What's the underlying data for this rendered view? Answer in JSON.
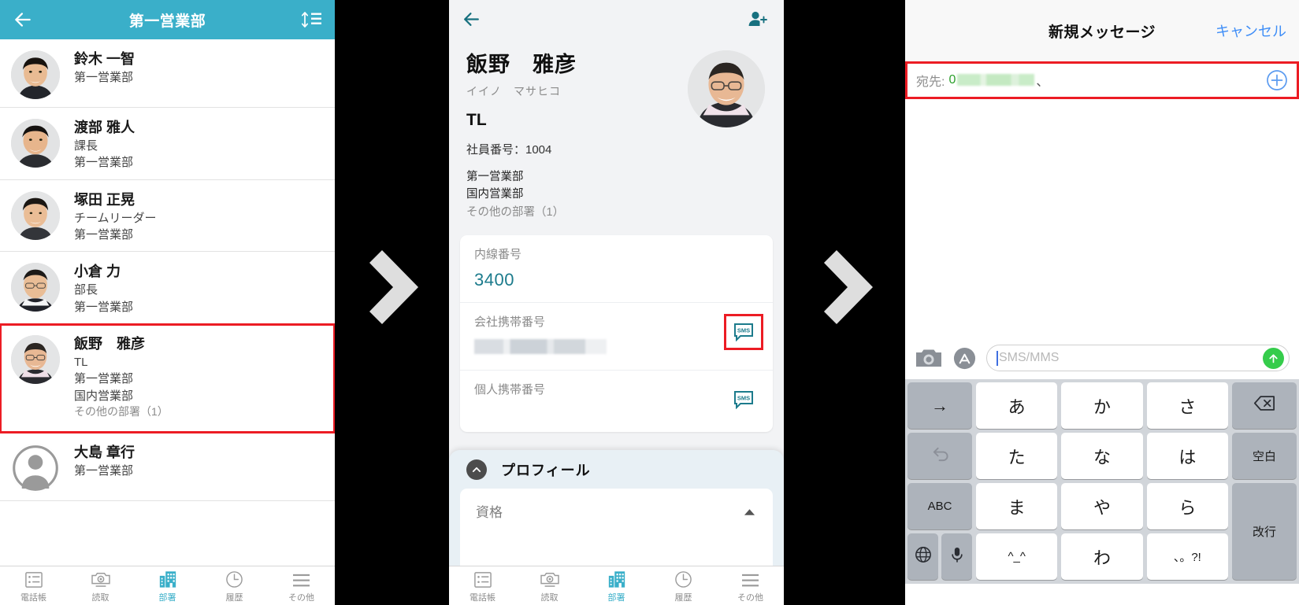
{
  "panel1": {
    "header": {
      "title": "第一営業部",
      "back_icon": "back-arrow-icon",
      "sort_icon": "sort-icon"
    },
    "rows": [
      {
        "name": "鈴木 一智",
        "role": "",
        "depts": [
          "第一営業部"
        ],
        "other": "",
        "selected": false,
        "avatar": "photo-man-1"
      },
      {
        "name": "渡部 雅人",
        "role": "課長",
        "depts": [
          "第一営業部"
        ],
        "other": "",
        "selected": false,
        "avatar": "photo-man-2"
      },
      {
        "name": "塚田 正晃",
        "role": "チームリーダー",
        "depts": [
          "第一営業部"
        ],
        "other": "",
        "selected": false,
        "avatar": "photo-man-3"
      },
      {
        "name": "小倉 力",
        "role": "部長",
        "depts": [
          "第一営業部"
        ],
        "other": "",
        "selected": false,
        "avatar": "photo-man-4"
      },
      {
        "name": "飯野　雅彦",
        "role": "TL",
        "depts": [
          "第一営業部",
          "国内営業部"
        ],
        "other": "その他の部署（1）",
        "selected": true,
        "avatar": "photo-man-5"
      },
      {
        "name": "大島 章行",
        "role": "",
        "depts": [
          "第一営業部"
        ],
        "other": "",
        "selected": false,
        "avatar": "placeholder-person"
      }
    ]
  },
  "tabbar": {
    "items": [
      {
        "label": "電話帳",
        "icon": "contact-list-icon",
        "active": false
      },
      {
        "label": "読取",
        "icon": "camera-scan-icon",
        "active": false
      },
      {
        "label": "部署",
        "icon": "building-icon",
        "active": true
      },
      {
        "label": "履歴",
        "icon": "clock-icon",
        "active": false
      },
      {
        "label": "その他",
        "icon": "hamburger-icon",
        "active": false
      }
    ]
  },
  "panel2": {
    "back_icon": "back-arrow-icon",
    "adduser_icon": "add-person-icon",
    "person": {
      "name": "飯野　雅彦",
      "kana": "イイノ　マサヒコ",
      "role": "TL",
      "employee_no": "社員番号：1004",
      "depts": [
        "第一営業部",
        "国内営業部"
      ],
      "other_depts": "その他の部署（1）"
    },
    "fields": [
      {
        "label": "内線番号",
        "value": "3400",
        "redacted": false,
        "sms": false
      },
      {
        "label": "会社携帯番号",
        "value": "",
        "redacted": true,
        "sms": true,
        "sms_highlighted": true
      },
      {
        "label": "個人携帯番号",
        "value": "",
        "redacted": false,
        "sms": true,
        "sms_highlighted": false
      }
    ],
    "profile_sheet": {
      "title": "プロフィール",
      "collapse_icon": "chevron-up-icon",
      "row_label": "資格",
      "row_caret": "caret-up-icon"
    }
  },
  "panel3": {
    "nav": {
      "title": "新規メッセージ",
      "cancel": "キャンセル"
    },
    "to_field": {
      "label": "宛先:",
      "value_prefix": "0",
      "value_redacted": true,
      "separator": "、",
      "add_icon": "add-circle-icon"
    },
    "input_bar": {
      "camera_icon": "camera-icon",
      "appstore_icon": "app-store-icon",
      "placeholder": "SMS/MMS",
      "send_icon": "send-arrow-icon"
    },
    "keyboard": {
      "rows": [
        [
          {
            "label": "→",
            "style": "gray"
          },
          {
            "label": "あ",
            "style": "white"
          },
          {
            "label": "か",
            "style": "white"
          },
          {
            "label": "さ",
            "style": "white"
          },
          {
            "label": "⌫",
            "style": "gray",
            "icon": "backspace-icon"
          }
        ],
        [
          {
            "label": "↺",
            "style": "gray",
            "icon": "undo-icon"
          },
          {
            "label": "た",
            "style": "white"
          },
          {
            "label": "な",
            "style": "white"
          },
          {
            "label": "は",
            "style": "white"
          },
          {
            "label": "空白",
            "style": "gray"
          }
        ],
        [
          {
            "label": "ABC",
            "style": "gray"
          },
          {
            "label": "ま",
            "style": "white"
          },
          {
            "label": "や",
            "style": "white"
          },
          {
            "label": "ら",
            "style": "white"
          },
          {
            "label": "改行",
            "style": "gray"
          }
        ],
        [
          {
            "label": "🌐",
            "style": "gray",
            "icon": "globe-icon"
          },
          {
            "label": "🎤",
            "style": "gray",
            "icon": "mic-icon"
          },
          {
            "label": "^_^",
            "style": "white"
          },
          {
            "label": "わ",
            "style": "white"
          },
          {
            "label": "、。?!",
            "style": "white"
          }
        ]
      ],
      "globe_icon": "globe-icon",
      "mic_icon": "mic-icon",
      "backspace_icon": "backspace-icon",
      "undo_icon": "undo-icon",
      "space_label": "空白",
      "return_label": "改行",
      "abc_label": "ABC",
      "arrow_label": "→",
      "emoji_label": "^_^",
      "wa_label": "わ",
      "punct_label": "、。?!"
    }
  },
  "colors": {
    "accent_cyan": "#3aafc9",
    "teal": "#1c7b8c",
    "highlight_red": "#ec1c24",
    "link_blue": "#3f8ef7",
    "send_green": "#35cc4b"
  }
}
